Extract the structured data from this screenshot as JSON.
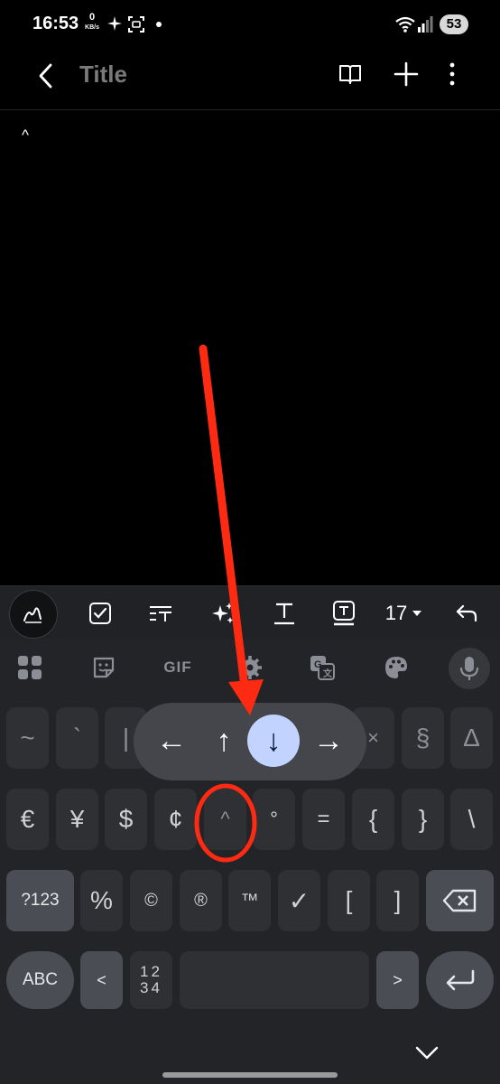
{
  "status_bar": {
    "time": "16:53",
    "net_speed_value": "0",
    "net_speed_unit": "KB/s",
    "battery": "53"
  },
  "app_bar": {
    "title": "Title"
  },
  "note": {
    "content": "^"
  },
  "toolbar": {
    "font_size": "17"
  },
  "keyboard": {
    "top_row": {
      "gif_label": "GIF"
    },
    "row1": [
      "~",
      "`",
      "|",
      "×",
      "§",
      "Δ"
    ],
    "row2": [
      "€",
      "¥",
      "$",
      "¢",
      "^",
      "°",
      "=",
      "{",
      "}",
      "\\"
    ],
    "row3": [
      "?123",
      "%",
      "©",
      "®",
      "™",
      "✓",
      "[",
      "]"
    ],
    "row4": {
      "abc": "ABC",
      "less": "<",
      "numpad_top": "12",
      "numpad_bottom": "34",
      "greater": ">"
    },
    "popup_arrows": [
      "←",
      "↑",
      "↓",
      "→"
    ],
    "popup_selected_index": 2
  },
  "colors": {
    "annotation_red": "#ff2a12",
    "popup_selected_bg": "#c2d3ff",
    "keyboard_bg": "#232427",
    "key_bg": "#2f3034",
    "modifier_key_bg": "#4a4d53"
  }
}
